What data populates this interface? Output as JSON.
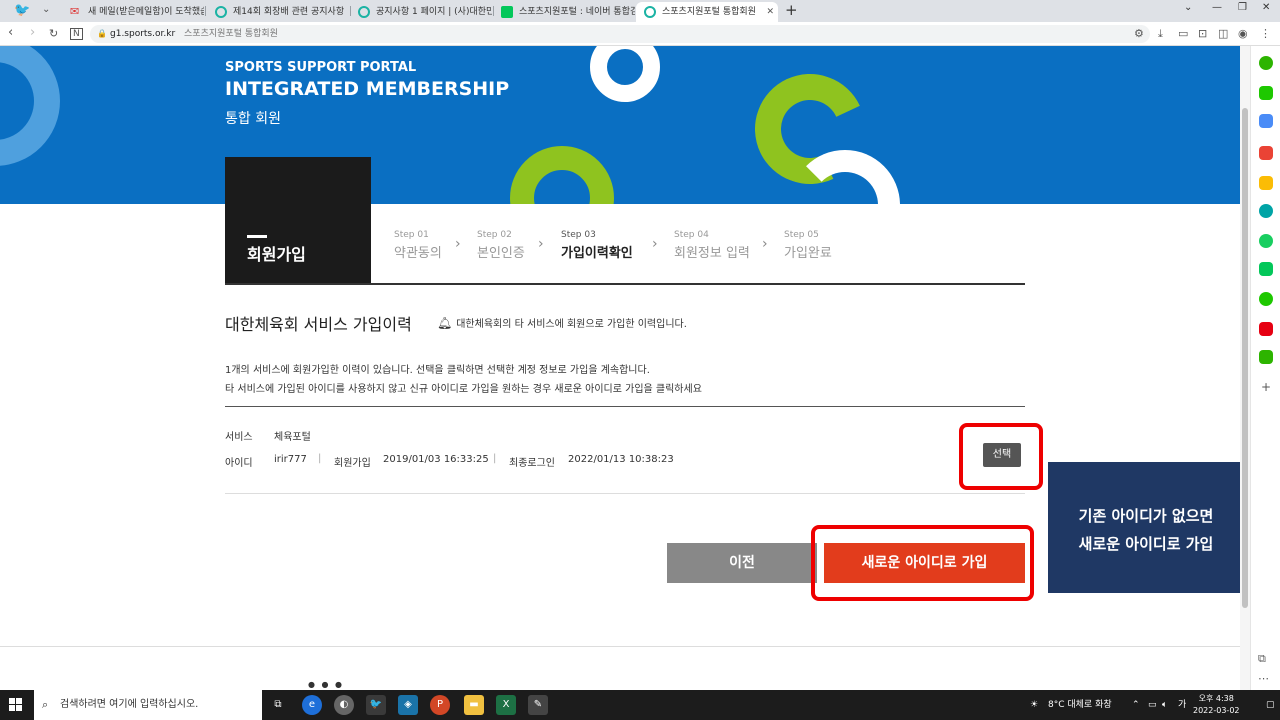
{
  "browser": {
    "tabs": [
      {
        "title": "새 메일(받은메일함)이 도착했습"
      },
      {
        "title": "제14회 회장배 관련 공지사항"
      },
      {
        "title": "공지사항 1 페이지 | (사)대한민"
      },
      {
        "title": "스포츠지원포털 : 네이버 통합검"
      },
      {
        "title": "스포츠지원포털 통합회원"
      }
    ],
    "url": "g1.sports.or.kr",
    "page_title": "스포츠지원포털 통합회원"
  },
  "hero": {
    "subtitle": "SPORTS SUPPORT PORTAL",
    "title": "INTEGRATED MEMBERSHIP",
    "korean": "통합 회원"
  },
  "page_label": "회원가입",
  "steps": [
    {
      "num": "Step 01",
      "name": "약관동의"
    },
    {
      "num": "Step 02",
      "name": "본인인증"
    },
    {
      "num": "Step 03",
      "name": "가입이력확인"
    },
    {
      "num": "Step 04",
      "name": "회원정보 입력"
    },
    {
      "num": "Step 05",
      "name": "가입완료"
    }
  ],
  "active_step": 3,
  "section": {
    "title": "대한체육회 서비스 가입이력",
    "note": "대한체육회의 타 서비스에 회원으로 가입한 이력입니다.",
    "desc1": "1개의 서비스에 회원가입한 이력이 있습니다. 선택을 클릭하면 선택한 계정 정보로 가입을 계속합니다.",
    "desc2": "타 서비스에 가입된 아이디를 사용하지 않고 신규 아이디로 가입을 원하는 경우 새로운 아이디로 가입을 클릭하세요"
  },
  "record": {
    "service_label": "서비스",
    "service_value": "체육포털",
    "id_label": "아이디",
    "id_value": "irir777",
    "join_label": "회원가입",
    "join_value": "2019/01/03 16:33:25",
    "login_label": "최종로그인",
    "login_value": "2022/01/13 10:38:23",
    "select_label": "선택"
  },
  "buttons": {
    "prev": "이전",
    "new_id": "새로운 아이디로 가입"
  },
  "callout": {
    "line1": "기존 아이디가 없으면",
    "line2": "새로운 아이디로 가입"
  },
  "taskbar": {
    "search_placeholder": "검색하려면 여기에 입력하십시오.",
    "weather": "8°C  대체로 화창",
    "time": "오후 4:38",
    "date": "2022-03-02"
  },
  "colors": {
    "hero_blue": "#0a6fc2",
    "accent_green": "#8fc31f",
    "primary_red": "#e23c1c",
    "callout_navy": "#1f3864",
    "highlight": "#ee0000"
  }
}
